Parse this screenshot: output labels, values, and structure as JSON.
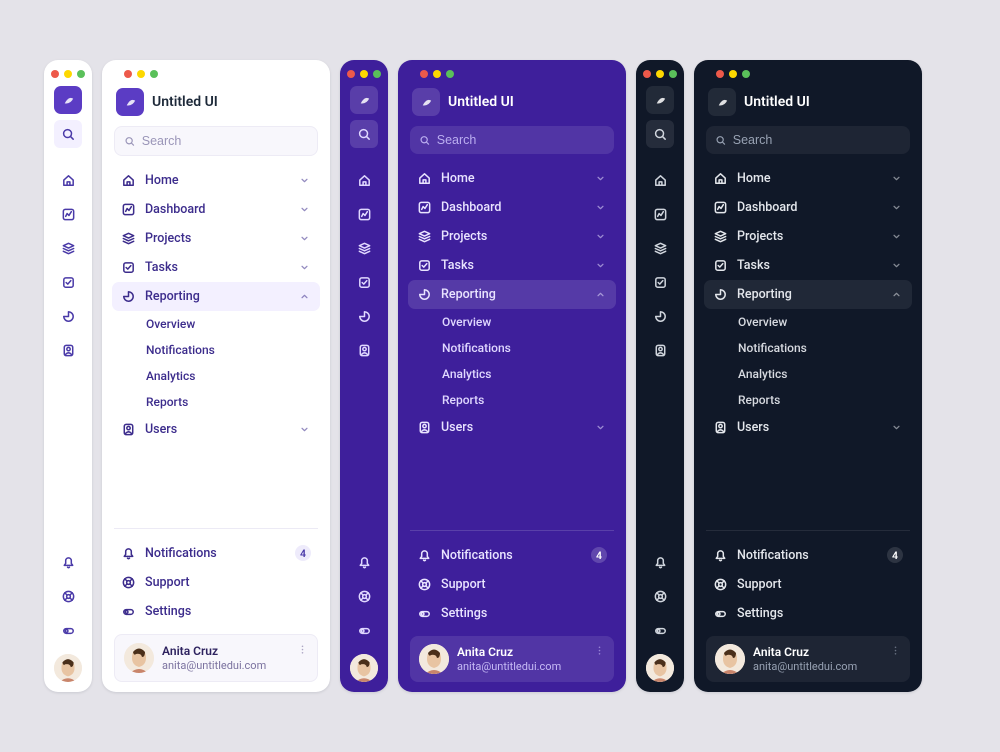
{
  "brand": {
    "name": "Untitled UI"
  },
  "search": {
    "placeholder": "Search"
  },
  "nav": {
    "home": {
      "label": "Home"
    },
    "dashboard": {
      "label": "Dashboard"
    },
    "projects": {
      "label": "Projects"
    },
    "tasks": {
      "label": "Tasks"
    },
    "reporting": {
      "label": "Reporting"
    },
    "users": {
      "label": "Users"
    }
  },
  "sub": {
    "overview": {
      "label": "Overview"
    },
    "notifications": {
      "label": "Notifications"
    },
    "analytics": {
      "label": "Analytics"
    },
    "reports": {
      "label": "Reports"
    }
  },
  "footer": {
    "notifications": {
      "label": "Notifications",
      "badge": "4"
    },
    "support": {
      "label": "Support"
    },
    "settings": {
      "label": "Settings"
    }
  },
  "user": {
    "name": "Anita Cruz",
    "email": "anita@untitledui.com"
  }
}
